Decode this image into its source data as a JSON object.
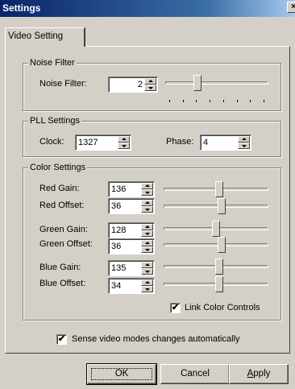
{
  "window": {
    "title": "Settings",
    "close_label": "×"
  },
  "tabs": [
    {
      "label": "Video Setting",
      "active": true
    }
  ],
  "noise_filter": {
    "group_title": "Noise Filter",
    "label": "Noise Filter:",
    "value": "2",
    "slider_fraction": 0.3,
    "tick_count": 8
  },
  "pll": {
    "group_title": "PLL Settings",
    "clock_label": "Clock:",
    "clock_value": "1327",
    "phase_label": "Phase:",
    "phase_value": "4"
  },
  "color": {
    "group_title": "Color Settings",
    "rows": [
      {
        "label": "Red Gain:",
        "value": "136",
        "slider_fraction": 0.53
      },
      {
        "label": "Red Offset:",
        "value": "36",
        "slider_fraction": 0.56
      },
      {
        "label": "Green Gain:",
        "value": "128",
        "slider_fraction": 0.5
      },
      {
        "label": "Green Offset:",
        "value": "36",
        "slider_fraction": 0.56
      },
      {
        "label": "Blue Gain:",
        "value": "135",
        "slider_fraction": 0.53
      },
      {
        "label": "Blue Offset:",
        "value": "34",
        "slider_fraction": 0.53
      }
    ],
    "link_checkbox": {
      "label": "Link Color Controls",
      "checked": true
    }
  },
  "sense_checkbox": {
    "label": "Sense video modes changes automatically",
    "checked": true
  },
  "buttons": {
    "ok": "OK",
    "cancel": "Cancel",
    "apply_prefix": "",
    "apply_accel": "A",
    "apply_rest": "pply"
  }
}
